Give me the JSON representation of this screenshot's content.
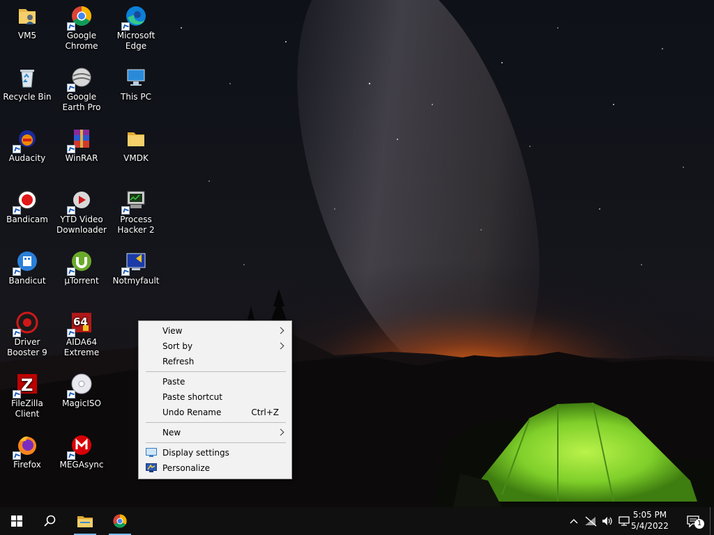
{
  "desktop": {
    "icons": [
      {
        "label": "VM5",
        "icon": "user-folder-icon"
      },
      {
        "label": "Google Chrome",
        "icon": "chrome-icon"
      },
      {
        "label": "Microsoft Edge",
        "icon": "edge-icon"
      },
      {
        "label": "Recycle Bin",
        "icon": "recycle-bin-icon"
      },
      {
        "label": "Google Earth Pro",
        "icon": "google-earth-icon"
      },
      {
        "label": "This PC",
        "icon": "this-pc-icon"
      },
      {
        "label": "Audacity",
        "icon": "audacity-icon"
      },
      {
        "label": "WinRAR",
        "icon": "winrar-icon"
      },
      {
        "label": "VMDK",
        "icon": "folder-icon"
      },
      {
        "label": "Bandicam",
        "icon": "bandicam-icon"
      },
      {
        "label": "YTD Video Downloader",
        "icon": "ytd-icon"
      },
      {
        "label": "Process Hacker 2",
        "icon": "process-hacker-icon"
      },
      {
        "label": "Bandicut",
        "icon": "bandicut-icon"
      },
      {
        "label": "µTorrent",
        "icon": "utorrent-icon"
      },
      {
        "label": "Notmyfault",
        "icon": "notmyfault-icon"
      },
      {
        "label": "Driver Booster 9",
        "icon": "driver-booster-icon"
      },
      {
        "label": "AIDA64 Extreme",
        "icon": "aida64-icon"
      },
      {
        "label": "FileZilla Client",
        "icon": "filezilla-icon"
      },
      {
        "label": "MagicISO",
        "icon": "magiciso-icon"
      },
      {
        "label": "Firefox",
        "icon": "firefox-icon"
      },
      {
        "label": "MEGAsync",
        "icon": "megasync-icon"
      }
    ]
  },
  "context_menu": {
    "view": "View",
    "sort_by": "Sort by",
    "refresh": "Refresh",
    "paste": "Paste",
    "paste_shortcut": "Paste shortcut",
    "undo_rename": "Undo Rename",
    "undo_shortcut": "Ctrl+Z",
    "new": "New",
    "display_settings": "Display settings",
    "personalize": "Personalize"
  },
  "taskbar": {
    "time": "5:05 PM",
    "date": "5/4/2022",
    "notification_count": "1",
    "pinned": [
      "file-explorer-icon",
      "chrome-icon"
    ],
    "tray_icons": [
      "chevron-up-icon",
      "network-off-icon",
      "volume-icon",
      "display-icon"
    ]
  },
  "colors": {
    "accent": "#76b9ed",
    "taskbar_bg": "#101010",
    "menu_bg": "#f2f2f2"
  }
}
